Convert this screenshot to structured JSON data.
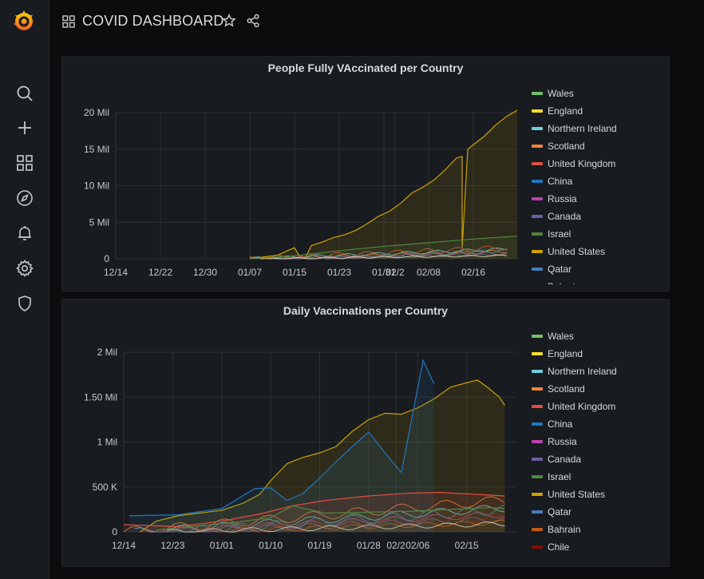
{
  "dashboard": {
    "title": "COVID DASHBOARD"
  },
  "sidebar": {
    "icons": [
      "search-icon",
      "plus-icon",
      "dashboards-icon",
      "explore-icon",
      "alerting-icon",
      "settings-icon",
      "shield-icon"
    ]
  },
  "colors": {
    "Wales": "#73bf69",
    "England": "#fade2a",
    "Northern Ireland": "#6ed0e0",
    "Scotland": "#ef843c",
    "United Kingdom": "#e24d42",
    "China": "#1f78c1",
    "Russia": "#ba43a9",
    "Canada": "#705da0",
    "Israel": "#508642",
    "United States": "#cca300",
    "Qatar": "#447ebc",
    "Bahrain": "#c15c17",
    "Chile": "#890f02"
  },
  "panel1": {
    "title": "People Fully VAccinated per Country",
    "legend": [
      "Wales",
      "England",
      "Northern Ireland",
      "Scotland",
      "United Kingdom",
      "China",
      "Russia",
      "Canada",
      "Israel",
      "United States",
      "Qatar",
      "Bahrain"
    ]
  },
  "panel2": {
    "title": "Daily Vaccinations per Country",
    "legend": [
      "Wales",
      "England",
      "Northern Ireland",
      "Scotland",
      "United Kingdom",
      "China",
      "Russia",
      "Canada",
      "Israel",
      "United States",
      "Qatar",
      "Bahrain",
      "Chile"
    ]
  },
  "chart_data": [
    {
      "type": "area",
      "title": "People Fully VAccinated per Country",
      "x_ticks": [
        "12/14",
        "12/22",
        "12/30",
        "01/07",
        "01/15",
        "01/23",
        "01/31",
        "02/08",
        "02/16",
        "02/2"
      ],
      "y_ticks": [
        "0",
        "5 Mil",
        "10 Mil",
        "15 Mil",
        "20 Mil"
      ],
      "ylim": [
        0,
        20000000
      ],
      "legend_position": "right",
      "series": [
        {
          "name": "United States",
          "x": [
            "01/07",
            "01/08",
            "01/10",
            "01/12",
            "01/14",
            "01/15",
            "01/16",
            "01/17",
            "01/18",
            "01/20",
            "01/22",
            "01/24",
            "01/26",
            "01/28",
            "01/30",
            "02/01",
            "02/03",
            "02/05",
            "02/07",
            "02/09",
            "02/11",
            "02/13",
            "02/14",
            "02/14",
            "02/15",
            "02/16",
            "02/18",
            "02/20",
            "02/22",
            "02/24"
          ],
          "y": [
            0,
            100000,
            300000,
            500000,
            1200000,
            1500000,
            200000,
            200000,
            1800000,
            2300000,
            2900000,
            3300000,
            3900000,
            4800000,
            5800000,
            6500000,
            7600000,
            9000000,
            9800000,
            10800000,
            12200000,
            13800000,
            14000000,
            1500000,
            15000000,
            15600000,
            16800000,
            18300000,
            19500000,
            20400000
          ]
        },
        {
          "name": "Israel",
          "x": [
            "01/07",
            "01/15",
            "01/23",
            "01/31",
            "02/08",
            "02/16",
            "02/24"
          ],
          "y": [
            0,
            400000,
            1100000,
            1700000,
            2200000,
            2700000,
            3100000
          ]
        }
      ]
    },
    {
      "type": "area",
      "title": "Daily Vaccinations per Country",
      "x_ticks": [
        "12/14",
        "12/23",
        "01/01",
        "01/10",
        "01/19",
        "01/28",
        "02/06",
        "02/15",
        "02/2"
      ],
      "y_ticks": [
        "0",
        "500 K",
        "1 Mil",
        "1.50 Mil",
        "2 Mil"
      ],
      "ylim": [
        0,
        2000000
      ],
      "legend_position": "right",
      "series": [
        {
          "name": "United States",
          "x": [
            "12/17",
            "12/20",
            "12/24",
            "12/28",
            "01/01",
            "01/05",
            "01/08",
            "01/10",
            "01/13",
            "01/16",
            "01/19",
            "01/22",
            "01/25",
            "01/28",
            "01/31",
            "02/03",
            "02/06",
            "02/09",
            "02/12",
            "02/15",
            "02/17",
            "02/19",
            "02/21",
            "02/22"
          ],
          "y": [
            0,
            120000,
            180000,
            210000,
            240000,
            320000,
            420000,
            570000,
            760000,
            830000,
            880000,
            950000,
            1120000,
            1250000,
            1320000,
            1310000,
            1380000,
            1480000,
            1610000,
            1660000,
            1690000,
            1600000,
            1500000,
            1410000
          ]
        },
        {
          "name": "China",
          "x": [
            "12/15",
            "12/24",
            "01/01",
            "01/07",
            "01/10",
            "01/13",
            "01/16",
            "01/19",
            "01/22",
            "01/25",
            "01/28",
            "01/31",
            "02/03",
            "02/07",
            "02/09"
          ],
          "y": [
            180000,
            190000,
            260000,
            480000,
            490000,
            350000,
            430000,
            600000,
            780000,
            950000,
            1110000,
            880000,
            660000,
            1910000,
            1650000
          ]
        },
        {
          "name": "United Kingdom",
          "x": [
            "12/14",
            "12/24",
            "01/01",
            "01/08",
            "01/14",
            "01/20",
            "01/28",
            "02/04",
            "02/10",
            "02/16",
            "02/22"
          ],
          "y": [
            80000,
            60000,
            120000,
            200000,
            290000,
            350000,
            400000,
            430000,
            440000,
            420000,
            400000
          ]
        },
        {
          "name": "Israel",
          "x": [
            "12/20",
            "12/28",
            "01/04",
            "01/10",
            "01/14",
            "01/20",
            "01/28",
            "02/05",
            "02/12",
            "02/19",
            "02/22"
          ],
          "y": [
            20000,
            70000,
            110000,
            160000,
            290000,
            210000,
            220000,
            230000,
            250000,
            270000,
            260000
          ]
        }
      ]
    }
  ]
}
